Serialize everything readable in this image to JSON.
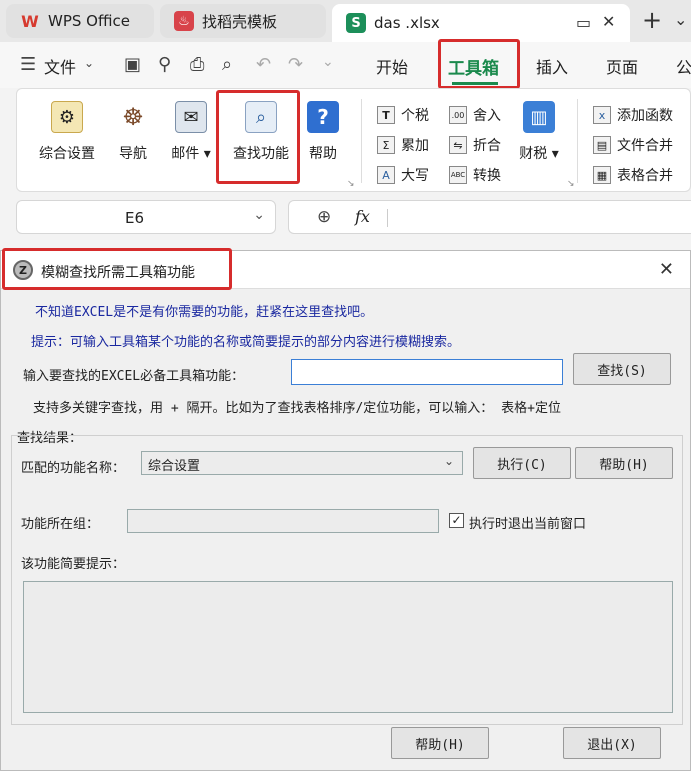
{
  "tabs": [
    {
      "label": "WPS Office"
    },
    {
      "label": "找稻壳模板"
    },
    {
      "label": "das .xlsx"
    }
  ],
  "menu": {
    "file": "文件",
    "items": [
      "开始",
      "工具箱",
      "插入",
      "页面",
      "公"
    ]
  },
  "ribbon": {
    "big_buttons": [
      "综合设置",
      "导航",
      "邮件",
      "查找功能",
      "帮助"
    ],
    "small_col1": [
      "个税",
      "累加",
      "大写"
    ],
    "small_col2": [
      "舍入",
      "折合",
      "转换"
    ],
    "tax_button": "财税",
    "small_col3": [
      "添加函数",
      "文件合并",
      "表格合并"
    ]
  },
  "formula_bar": {
    "cell_ref": "E6",
    "fx": "fx"
  },
  "dialog": {
    "title": "模糊查找所需工具箱功能",
    "hint1": "不知道EXCEL是不是有你需要的功能，赶紧在这里查找吧。",
    "hint2": "提示：可输入工具箱某个功能的名称或简要提示的部分内容进行模糊搜索。",
    "input_label": "输入要查找的EXCEL必备工具箱功能：",
    "search_value": "",
    "search_button": "查找(S)",
    "multi_keyword": "支持多关键字查找，用 + 隔开。比如为了查找表格排序/定位功能，可以输入： 表格+定位",
    "results_label": "查找结果：",
    "match_label": "匹配的功能名称：",
    "match_value": "综合设置",
    "execute_button": "执行(C)",
    "help_button_top": "帮助(H)",
    "group_label": "功能所在组：",
    "group_value": "",
    "exit_checkbox_label": "执行时退出当前窗口",
    "exit_checkbox_checked": true,
    "brief_label": "该功能简要提示：",
    "help_button_bottom": "帮助(H)",
    "exit_button": "退出(X)"
  }
}
